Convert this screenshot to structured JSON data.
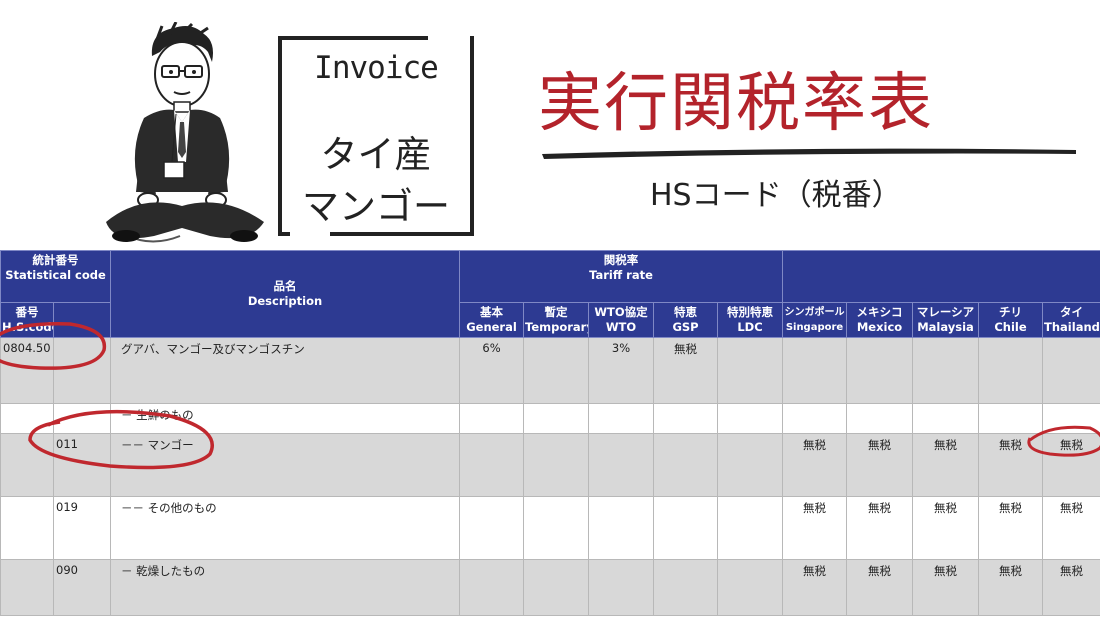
{
  "header": {
    "invoice_label": "Invoice",
    "invoice_line1": "タイ産",
    "invoice_line2": "マンゴー",
    "title": "実行関税率表",
    "subtitle": "HSコード（税番）"
  },
  "table": {
    "stat_code_jp": "統計番号",
    "stat_code_en": "Statistical code",
    "hs_jp": "番号",
    "hs_en": "H.S.code",
    "desc_jp": "品名",
    "desc_en": "Description",
    "tariff_jp": "関税率",
    "tariff_en": "Tariff rate",
    "rate_cols": [
      {
        "jp": "基本",
        "en": "General"
      },
      {
        "jp": "暫定",
        "en": "Temporary"
      },
      {
        "jp": "WTO協定",
        "en": "WTO"
      },
      {
        "jp": "特恵",
        "en": "GSP"
      },
      {
        "jp": "特別特恵",
        "en": "LDC"
      }
    ],
    "epa_cols": [
      {
        "jp": "シンガポール",
        "en": "Singapore"
      },
      {
        "jp": "メキシコ",
        "en": "Mexico"
      },
      {
        "jp": "マレーシア",
        "en": "Malaysia"
      },
      {
        "jp": "チリ",
        "en": "Chile"
      },
      {
        "jp": "タイ",
        "en": "Thailand"
      }
    ],
    "rows": [
      {
        "hs": "0804.50",
        "stat": "",
        "desc": "グアバ、マンゴー及びマンゴスチン",
        "general": "6%",
        "temporary": "",
        "wto": "3%",
        "gsp": "無税",
        "ldc": "",
        "epa": [
          "",
          "",
          "",
          "",
          ""
        ]
      },
      {
        "hs": "",
        "stat": "",
        "desc": "－ 生鮮のもの",
        "general": "",
        "temporary": "",
        "wto": "",
        "gsp": "",
        "ldc": "",
        "epa": [
          "",
          "",
          "",
          "",
          ""
        ]
      },
      {
        "hs": "",
        "stat": "011",
        "desc": "－－ マンゴー",
        "general": "",
        "temporary": "",
        "wto": "",
        "gsp": "",
        "ldc": "",
        "epa": [
          "無税",
          "無税",
          "無税",
          "無税",
          "無税"
        ]
      },
      {
        "hs": "",
        "stat": "019",
        "desc": "－－ その他のもの",
        "general": "",
        "temporary": "",
        "wto": "",
        "gsp": "",
        "ldc": "",
        "epa": [
          "無税",
          "無税",
          "無税",
          "無税",
          "無税"
        ]
      },
      {
        "hs": "",
        "stat": "090",
        "desc": "－ 乾燥したもの",
        "general": "",
        "temporary": "",
        "wto": "",
        "gsp": "",
        "ldc": "",
        "epa": [
          "無税",
          "無税",
          "無税",
          "無税",
          "無税"
        ]
      }
    ]
  },
  "colors": {
    "title_red": "#b3232b",
    "header_blue": "#2d3a92",
    "row_gray": "#d8d8d8",
    "circle_red": "#c0282e"
  }
}
